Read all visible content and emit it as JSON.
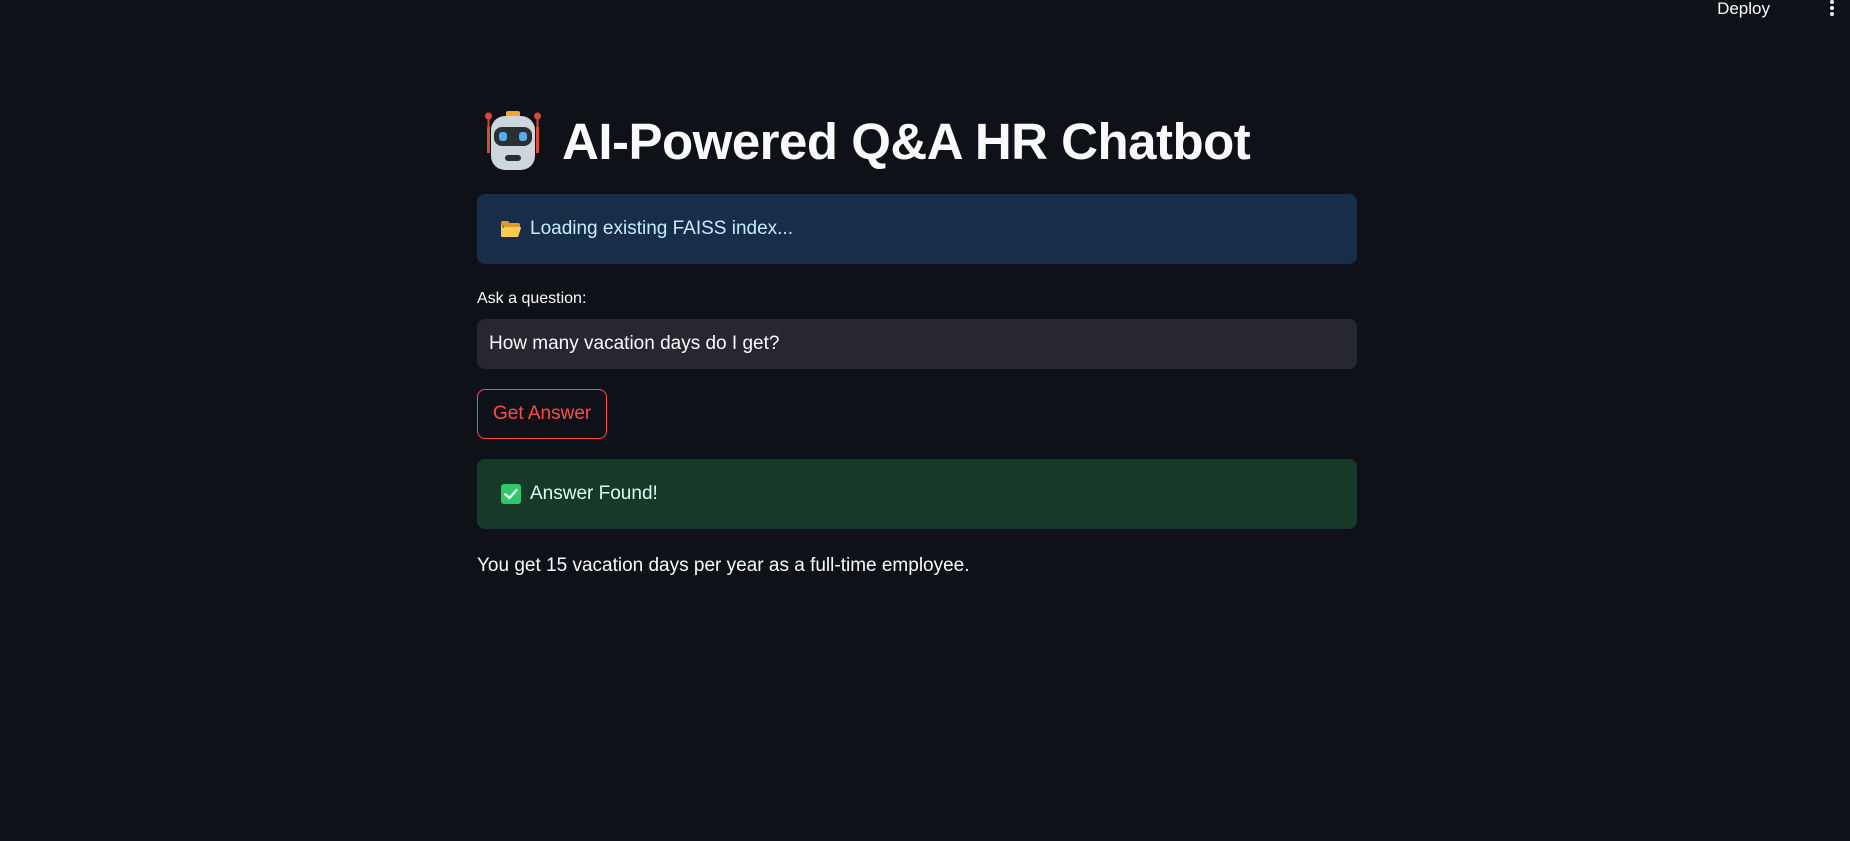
{
  "header": {
    "deploy_label": "Deploy",
    "menu_icon": "kebab-menu-icon"
  },
  "page": {
    "title_icon": "robot-emoji-icon",
    "title": "AI-Powered Q&A HR Chatbot"
  },
  "info_alert": {
    "icon": "open-folder-emoji-icon",
    "text": "Loading existing FAISS index..."
  },
  "question_input": {
    "label": "Ask a question:",
    "value": "How many vacation days do I get?"
  },
  "actions": {
    "get_answer_label": "Get Answer"
  },
  "success_alert": {
    "icon": "check-mark-emoji-icon",
    "text": "Answer Found!"
  },
  "answer": {
    "text": "You get 15 vacation days per year as a full-time employee."
  },
  "colors": {
    "background": "#0e1117",
    "primary": "#ff4b4b",
    "info_bg": "#172d48",
    "success_bg": "#173928",
    "input_bg": "#262730"
  }
}
